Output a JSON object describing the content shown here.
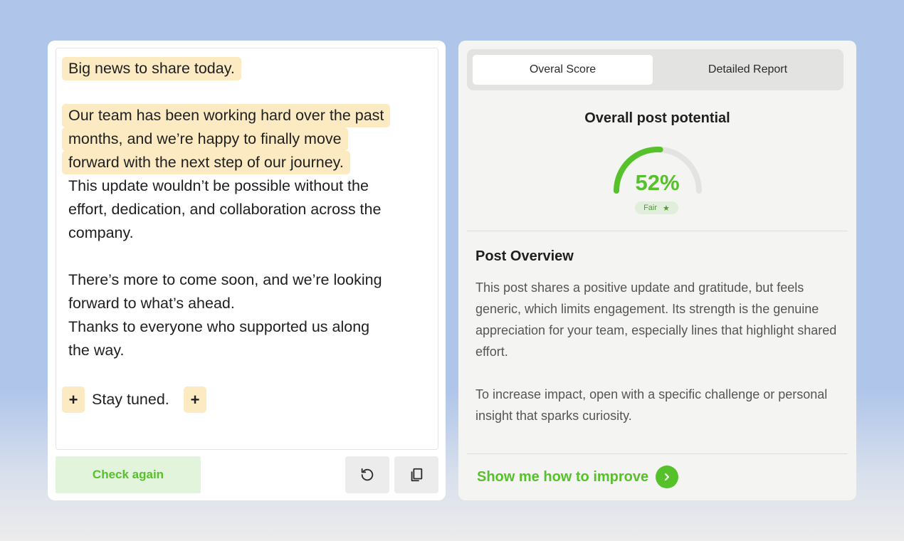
{
  "editor": {
    "lines": [
      "Big news to share today.",
      "Our team has been working hard over the past",
      "months, and we’re happy to finally move",
      "forward with the next step of our journey.",
      "This update wouldn’t be possible without the",
      "effort, dedication, and collaboration across the",
      "company.",
      "There’s more to come soon, and we’re looking",
      "forward to what’s ahead.",
      "Thanks to everyone who supported us along",
      "the way.",
      "Stay tuned."
    ],
    "plus_symbol": "+",
    "check_again_label": "Check again",
    "reset_icon": "reset-icon",
    "copy_icon": "copy-icon"
  },
  "score": {
    "tabs": [
      {
        "label": "Overal Score",
        "active": true
      },
      {
        "label": "Detailed Report",
        "active": false
      }
    ],
    "title": "Overall post potential",
    "percent_label": "52%",
    "percent_value": 0.52,
    "rating": "Fair",
    "rating_icon": "star-icon",
    "overview_title": "Post Overview",
    "overview_paragraphs": [
      "This post shares a positive update and gratitude, but feels generic, which limits engagement. Its strength is the genuine appreciation for your team, especially lines that highlight shared effort.",
      "To increase impact, open with a specific challenge or personal insight that sparks curiosity."
    ],
    "improve_label": "Show me how to improve",
    "improve_icon": "chevron-right-icon"
  },
  "colors": {
    "accent_green": "#56c12a",
    "highlight": "#fbeac2",
    "background": "#afc5ea"
  }
}
